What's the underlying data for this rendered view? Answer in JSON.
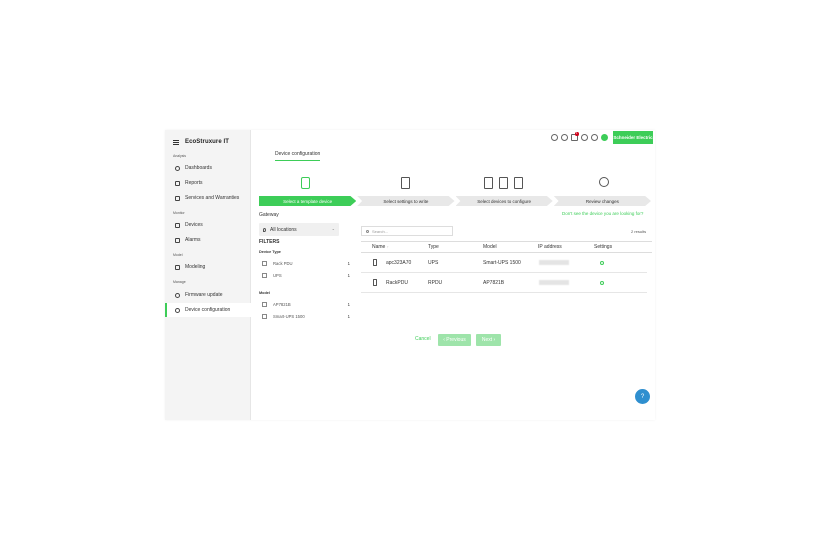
{
  "header": {
    "logo": "EcoStruxure IT",
    "brand": "Schneider Electric",
    "notification_count": "1"
  },
  "sidebar": {
    "sections": [
      {
        "label": "Analysis",
        "items": [
          {
            "label": "Dashboards"
          },
          {
            "label": "Reports"
          },
          {
            "label": "Services and Warranties"
          }
        ]
      },
      {
        "label": "Monitor",
        "items": [
          {
            "label": "Devices"
          },
          {
            "label": "Alarms"
          }
        ]
      },
      {
        "label": "Model",
        "items": [
          {
            "label": "Modeling"
          }
        ]
      },
      {
        "label": "Manage",
        "items": [
          {
            "label": "Firmware update"
          },
          {
            "label": "Device configuration"
          }
        ]
      }
    ]
  },
  "page": {
    "title": "Device configuration"
  },
  "stepper": {
    "steps": [
      "Select a template device",
      "Select settings to write",
      "Select devices to configure",
      "Review changes"
    ],
    "active_index": 0
  },
  "help_link": "Don't see the device you are looking for?",
  "gateway": {
    "label": "Gateway",
    "location": "All locations"
  },
  "filters": {
    "title": "FILTERS",
    "groups": [
      {
        "label": "Device Type",
        "options": [
          {
            "label": "Rack PDU",
            "count": "1"
          },
          {
            "label": "UPS",
            "count": "1"
          }
        ]
      },
      {
        "label": "Model",
        "options": [
          {
            "label": "AP7821B",
            "count": "1"
          },
          {
            "label": "Smart-UPS 1500",
            "count": "1"
          }
        ]
      }
    ]
  },
  "search": {
    "placeholder": "Search..."
  },
  "results": "2 results",
  "table": {
    "columns": [
      "Name",
      "Type",
      "Model",
      "IP address",
      "Settings"
    ],
    "rows": [
      {
        "name": "apc323A70",
        "type": "UPS",
        "model": "Smart-UPS 1500"
      },
      {
        "name": "RackPDU",
        "type": "RPDU",
        "model": "AP7821B"
      }
    ]
  },
  "footer": {
    "cancel": "Cancel",
    "previous": "‹ Previous",
    "next": "Next ›"
  }
}
